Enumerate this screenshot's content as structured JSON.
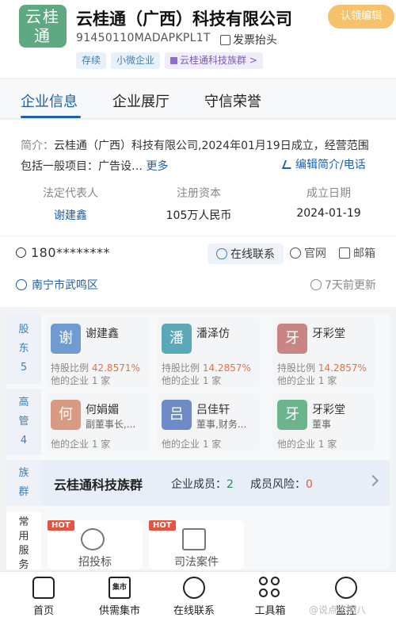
{
  "header": {
    "logo_text": "云桂\n通",
    "logo_line1": "云桂",
    "logo_line2": "通",
    "company_name": "云桂通（广西）科技有限公司",
    "claim_label": "认领编辑",
    "credit_code": "91450110MADAPKPL1T",
    "invoice_label": "发票抬头",
    "tags": [
      "存续",
      "小微企业",
      "云桂通科技族群 >"
    ]
  },
  "tabs": [
    "企业信息",
    "企业展厅",
    "守信荣誉"
  ],
  "info": {
    "intro_label": "简介：",
    "intro_text": "云桂通（广西）科技有限公司,2024年01月19日成立，经营范围包括一般项目：广告设…",
    "more_label": "更多",
    "edit_label": "编辑简介/电话",
    "stats": [
      {
        "k": "法定代表人",
        "v": "谢建鑫"
      },
      {
        "k": "注册资本",
        "v": "105万人民币"
      },
      {
        "k": "成立日期",
        "v": "2024-01-19"
      }
    ],
    "phone": "180********",
    "online_contact": "在线联系",
    "website": "官网",
    "email": "邮箱",
    "location": "南宁市武鸣区",
    "updated": "7天前更新"
  },
  "holders": {
    "shareholder_label": [
      "股",
      "东",
      "5"
    ],
    "manager_label": [
      "高",
      "管",
      "4"
    ],
    "group_label": [
      "族",
      "群"
    ],
    "service_label": [
      "常",
      "用",
      "服",
      "务"
    ],
    "shareholders": [
      {
        "avatar": "谢",
        "name": "谢建鑫",
        "pct_label": "持股比例",
        "pct": "42.8571%",
        "other": "他的企业 1 家",
        "color": "#6f9bd1"
      },
      {
        "avatar": "潘",
        "name": "潘泽仿",
        "pct_label": "持股比例",
        "pct": "14.2857%",
        "other": "他的企业 1 家",
        "color": "#5aa8b8"
      },
      {
        "avatar": "牙",
        "name": "牙彩堂",
        "pct_label": "持股比例",
        "pct": "14.2857%",
        "other": "他的企业 1 家",
        "color": "#c98484"
      }
    ],
    "managers": [
      {
        "avatar": "何",
        "name": "何娟媚",
        "role": "副董事长,...",
        "other": "他的企业 1 家",
        "color": "#d89a82"
      },
      {
        "avatar": "吕",
        "name": "吕佳轩",
        "role": "董事,财务...",
        "other": "他的企业 1 家",
        "color": "#6f8bc7"
      },
      {
        "avatar": "牙",
        "name": "牙彩堂",
        "role": "董事",
        "other": "他的企业 1 家",
        "color": "#6cb58c"
      }
    ],
    "group": {
      "name": "云桂通科技族群",
      "members_label": "企业成员：",
      "members": "2",
      "risk_label": "成员风险：",
      "risk": "0"
    },
    "services": [
      {
        "hot": "HOT",
        "label": "招投标"
      },
      {
        "hot": "HOT",
        "label": "司法案件"
      }
    ]
  },
  "bottom_nav": [
    {
      "label": "首页"
    },
    {
      "label": "供需集市",
      "icon_text": "集市"
    },
    {
      "label": "在线联系"
    },
    {
      "label": "工具箱"
    },
    {
      "label": "监控"
    }
  ],
  "watermark": "@说点文明八"
}
